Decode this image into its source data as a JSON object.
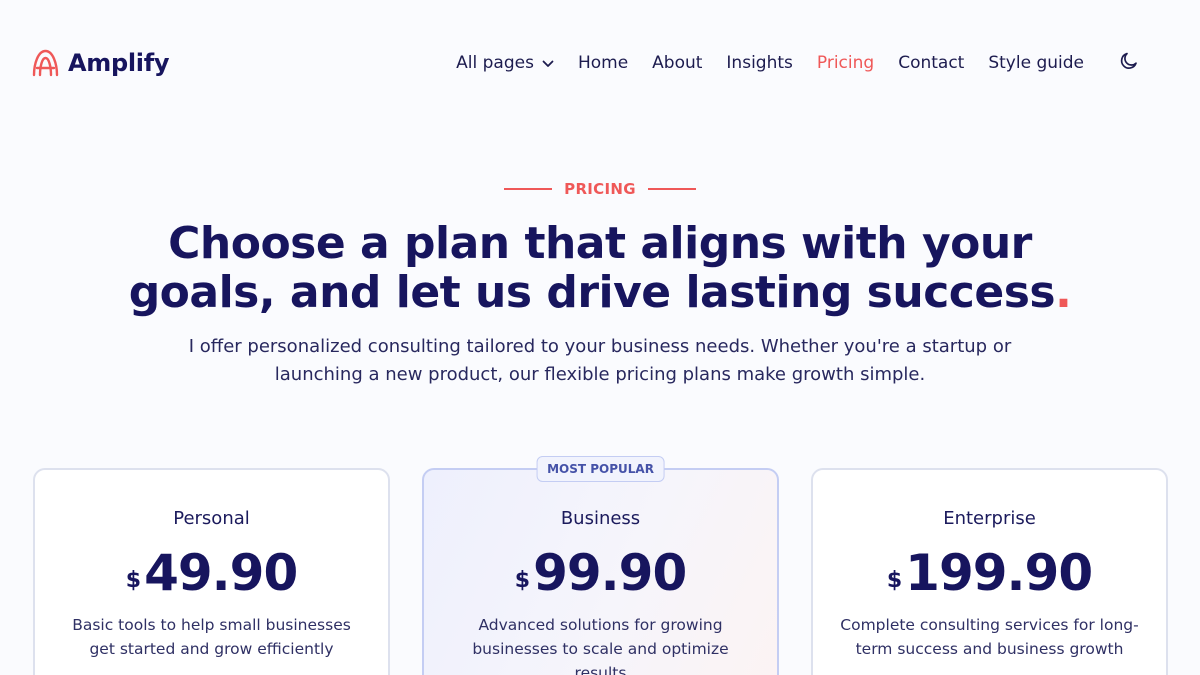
{
  "brand": {
    "name": "Amplify",
    "accent": "#ef5858",
    "primary": "#17155e"
  },
  "nav": {
    "all_pages": "All pages",
    "home": "Home",
    "about": "About",
    "insights": "Insights",
    "pricing": "Pricing",
    "contact": "Contact",
    "style_guide": "Style guide",
    "active": "Pricing"
  },
  "hero": {
    "eyebrow": "PRICING",
    "headline_line1": "Choose a plan that aligns with your",
    "headline_line2": "goals, and let us drive lasting success",
    "headline_dot": ".",
    "subtext_line1": "I offer personalized consulting tailored to your business needs. Whether you're a startup or",
    "subtext_line2": "launching a new product, our flexible pricing plans make growth simple."
  },
  "plans": [
    {
      "name": "Personal",
      "currency": "$",
      "price": "49.90",
      "description": "Basic tools to help small businesses get started and grow efficiently",
      "badge": ""
    },
    {
      "name": "Business",
      "currency": "$",
      "price": "99.90",
      "description": "Advanced solutions for growing businesses to scale and optimize results",
      "badge": "MOST POPULAR"
    },
    {
      "name": "Enterprise",
      "currency": "$",
      "price": "199.90",
      "description": "Complete consulting services for long-term success and business growth",
      "badge": ""
    }
  ],
  "icons": {
    "logo": "amplify-logo-icon",
    "dropdown": "chevron-down-icon",
    "theme": "moon-icon"
  }
}
